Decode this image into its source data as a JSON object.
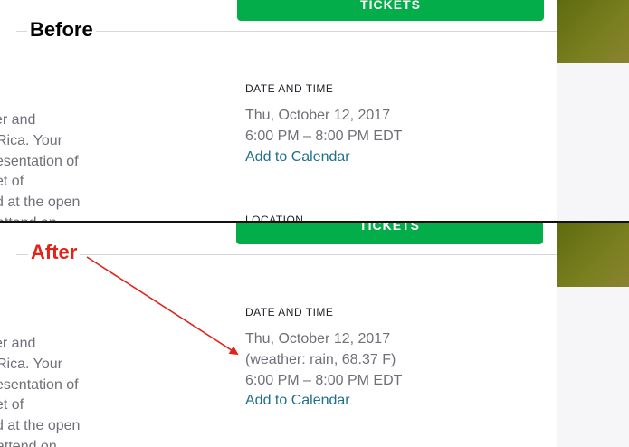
{
  "before": {
    "label": "Before",
    "tickets_label": "TICKETS",
    "left_lines": [
      "er and",
      "Rica. Your",
      "esentation of",
      "et of",
      "d at the open",
      "attend an"
    ],
    "date_time_heading": "DATE AND TIME",
    "date": "Thu, October 12, 2017",
    "time": "6:00 PM – 8:00 PM EDT",
    "add_to_calendar": "Add to Calendar",
    "location_heading": "LOCATION"
  },
  "after": {
    "label": "After",
    "tickets_label": "TICKETS",
    "left_lines": [
      "er and",
      "Rica. Your",
      "esentation of",
      "et of",
      "d at the open",
      "attend on"
    ],
    "date_time_heading": "DATE AND TIME",
    "date": "Thu, October 12, 2017",
    "weather": "(weather: rain, 68.37 F)",
    "time": "6:00 PM – 8:00 PM EDT",
    "add_to_calendar": "Add to Calendar"
  },
  "colors": {
    "tickets_green": "#03ad4a",
    "link_teal": "#1f6f8b",
    "after_label_red": "#e2231a",
    "arrow_red": "#e2231a"
  }
}
